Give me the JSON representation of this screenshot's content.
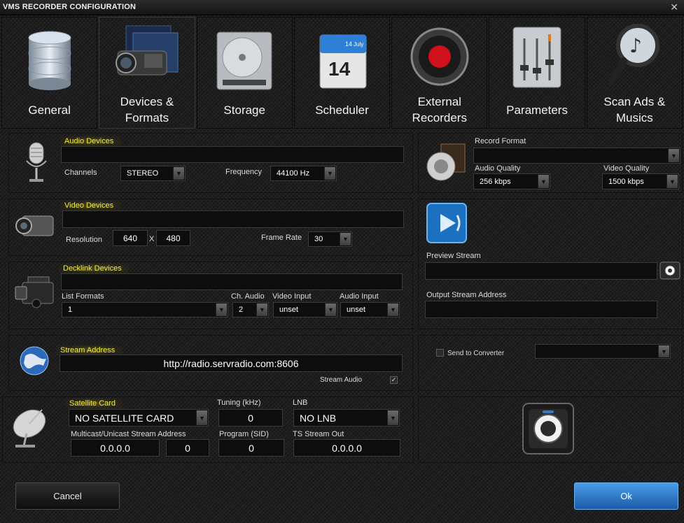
{
  "window": {
    "title": "VMS RECORDER CONFIGURATION",
    "close_glyph": "✕"
  },
  "tabs": [
    {
      "id": "general",
      "label": "General",
      "icon": "database-icon"
    },
    {
      "id": "devices",
      "label": "Devices & Formats",
      "icon": "camcorder-icon"
    },
    {
      "id": "storage",
      "label": "Storage",
      "icon": "hard-drive-icon"
    },
    {
      "id": "scheduler",
      "label": "Scheduler",
      "icon": "calendar-icon",
      "calendar_month": "July",
      "calendar_day_small": "14",
      "calendar_day": "14"
    },
    {
      "id": "external",
      "label": "External Recorders",
      "icon": "record-icon"
    },
    {
      "id": "parameters",
      "label": "Parameters",
      "icon": "mixer-icon"
    },
    {
      "id": "scanads",
      "label": "Scan Ads & Musics",
      "icon": "magnifier-music-icon"
    }
  ],
  "audio_devices": {
    "title": "Audio Devices",
    "device": "",
    "channels_label": "Channels",
    "channels_value": "STEREO",
    "frequency_label": "Frequency",
    "frequency_value": "44100 Hz"
  },
  "video_devices": {
    "title": "Video Devices",
    "device": "",
    "resolution_label": "Resolution",
    "width": "640",
    "x_sep": "X",
    "height": "480",
    "framerate_label": "Frame Rate",
    "framerate_value": "30"
  },
  "decklink": {
    "title": "Decklink Devices",
    "device": "",
    "list_formats_label": "List Formats",
    "list_formats_value": "1",
    "ch_audio_label": "Ch. Audio",
    "ch_audio_value": "2",
    "video_input_label": "Video Input",
    "video_input_value": "unset",
    "audio_input_label": "Audio Input",
    "audio_input_value": "unset"
  },
  "stream": {
    "title": "Stream Address",
    "address": "http://radio.servradio.com:8606",
    "stream_audio_label": "Stream Audio",
    "stream_audio_checked": true
  },
  "satellite": {
    "title": "Satellite Card",
    "card_value": "NO SATELLITE CARD",
    "tuning_label": "Tuning (kHz)",
    "tuning_value": "0",
    "lnb_label": "LNB",
    "lnb_value": "NO LNB",
    "multicast_label": "Multicast/Unicast Stream Address",
    "multicast_value": "0.0.0.0",
    "multicast_port": "0",
    "program_label": "Program (SID)",
    "program_value": "0",
    "ts_label": "TS Stream Out",
    "ts_value": "0.0.0.0"
  },
  "record_format": {
    "title": "Record Format",
    "format_value": "",
    "audio_quality_label": "Audio Quality",
    "audio_quality_value": "256 kbps",
    "video_quality_label": "Video Quality",
    "video_quality_value": "1500 kbps"
  },
  "preview": {
    "preview_label": "Preview Stream",
    "preview_value": "",
    "output_label": "Output Stream Address",
    "output_value": ""
  },
  "converter": {
    "label": "Send to Converter",
    "checked": false,
    "value": ""
  },
  "buttons": {
    "cancel": "Cancel",
    "ok": "Ok"
  },
  "colors": {
    "highlight_label": "#f3ee3a",
    "ok_button": "#2d78c8",
    "panel_bg": "#1f1f1f"
  }
}
